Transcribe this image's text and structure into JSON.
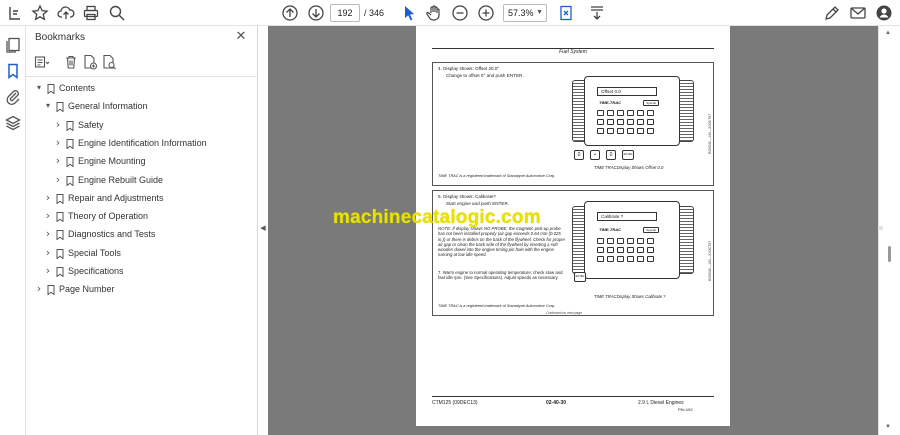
{
  "toolbar": {
    "page_current": "192",
    "page_total": "/ 346",
    "zoom": "57.3%"
  },
  "panel": {
    "title": "Bookmarks",
    "close_glyph": "✕"
  },
  "bookmarks": [
    {
      "label": "Contents",
      "level": 0,
      "state": "expanded"
    },
    {
      "label": "General Information",
      "level": 1,
      "state": "expanded"
    },
    {
      "label": "Safety",
      "level": 2,
      "state": "collapsed"
    },
    {
      "label": "Engine Identification Information",
      "level": 2,
      "state": "collapsed"
    },
    {
      "label": "Engine Mounting",
      "level": 2,
      "state": "collapsed"
    },
    {
      "label": "Engine Rebuilt Guide",
      "level": 2,
      "state": "collapsed"
    },
    {
      "label": "Repair and Adjustments",
      "level": 1,
      "state": "collapsed"
    },
    {
      "label": "Theory of Operation",
      "level": 1,
      "state": "collapsed"
    },
    {
      "label": "Diagnostics and Tests",
      "level": 1,
      "state": "collapsed"
    },
    {
      "label": "Special Tools",
      "level": 1,
      "state": "collapsed"
    },
    {
      "label": "Specifications",
      "level": 1,
      "state": "collapsed"
    },
    {
      "label": "Page Number",
      "level": 0,
      "state": "collapsed"
    }
  ],
  "document": {
    "header": "Fuel System",
    "step4_title": "4.  Display shows:  Offset  20.0°",
    "step4_body": "Change to offset 0° and push ENTER.",
    "screen1": "Offset   0.0",
    "brand": "TIME-TRAC",
    "key_special": "Special",
    "caption1": "TIME TRACDisplay Shows Offset  0.0",
    "trademark": "TIME TRAC is a registered trademark of Stanadyne Automotive Corp.",
    "step5_title": "5.  Display shows:  Calibrate?",
    "step6_body": "Start engine and push ENTER.",
    "note": "NOTE:  If display shows NO PROBE, the magnetic pick-up probe has not been installed properly (air gap exceeds 0.64 mm (0.025 in.)) or there is debris on the back of the flywheel. Check for proper air gap or clean the back side of the flywheel by inserting a soft wooden dowel into the engine timing pin hole with the engine running at low idle speed.",
    "screen2": "Calibrate  ?",
    "step7": "7.  Warm engine to normal operating temperature; check slow and fast idle rpm. (See Specifications). Adjust speeds as necessary.",
    "caption2": "TIME TRACDisplay Shows Calibrate ?",
    "continued": "Continued on next page",
    "footer_left": "CTM125 (09DEC13)",
    "footer_center": "02-40-30",
    "footer_right": "2.9 L Diesel Engines",
    "footer_right2": "PN=192",
    "btn_zero": "0",
    "btn_dot": "•",
    "btn_enter": "ENTER"
  },
  "watermark": "machinecatalogic.com"
}
